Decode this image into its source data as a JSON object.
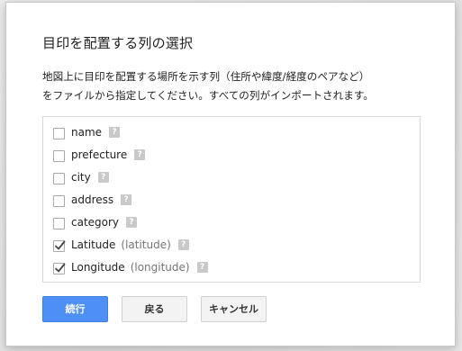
{
  "dialog": {
    "title": "目印を配置する列の選択",
    "description_line1": "地図上に目印を配置する場所を示す列（住所や緯度/経度のペアなど）",
    "description_line2": "をファイルから指定してください。すべての列がインポートされます。"
  },
  "columns": [
    {
      "name": "name",
      "sub": "",
      "checked": false
    },
    {
      "name": "prefecture",
      "sub": "",
      "checked": false
    },
    {
      "name": "city",
      "sub": "",
      "checked": false
    },
    {
      "name": "address",
      "sub": "",
      "checked": false
    },
    {
      "name": "category",
      "sub": "",
      "checked": false
    },
    {
      "name": "Latitude",
      "sub": "(latitude)",
      "checked": true
    },
    {
      "name": "Longitude",
      "sub": "(longitude)",
      "checked": true
    }
  ],
  "help_glyph": "?",
  "buttons": {
    "continue": "続行",
    "back": "戻る",
    "cancel": "キャンセル"
  },
  "colors": {
    "primary": "#4d8ff4",
    "help_icon": "#c9c9c9"
  }
}
